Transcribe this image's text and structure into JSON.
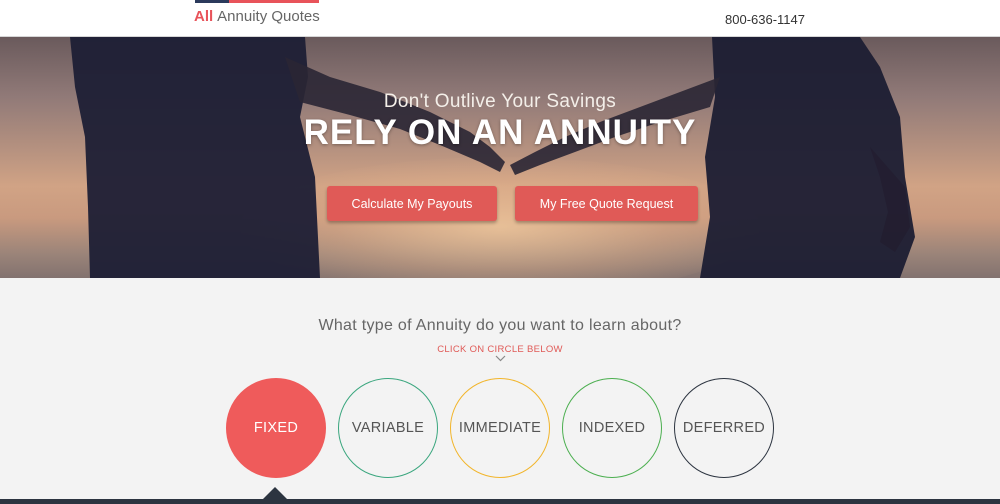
{
  "header": {
    "logo_bold": "All",
    "logo_rest": "Annuity Quotes",
    "phone": "800-636-1147",
    "stripe_colors": [
      "#2b3a5c",
      "#e8535a"
    ]
  },
  "hero": {
    "subtitle": "Don't Outlive Your Savings",
    "title": "RELY ON AN ANNUITY",
    "buttons": {
      "calculate": "Calculate My Payouts",
      "quote": "My Free Quote Request"
    }
  },
  "section": {
    "question": "What type of Annuity do you want to learn about?",
    "hint": "CLICK ON CIRCLE BELOW",
    "hint_icon": "chevron-down-icon"
  },
  "annuity_types": [
    {
      "label": "FIXED",
      "color": "#ef5b5b",
      "selected": true
    },
    {
      "label": "VARIABLE",
      "color": "#3aa67e",
      "selected": false
    },
    {
      "label": "IMMEDIATE",
      "color": "#f2b52b",
      "selected": false
    },
    {
      "label": "INDEXED",
      "color": "#4caf50",
      "selected": false
    },
    {
      "label": "DEFERRED",
      "color": "#2c3440",
      "selected": false
    }
  ],
  "colors": {
    "accent": "#e05a57",
    "dark": "#2c3440"
  }
}
